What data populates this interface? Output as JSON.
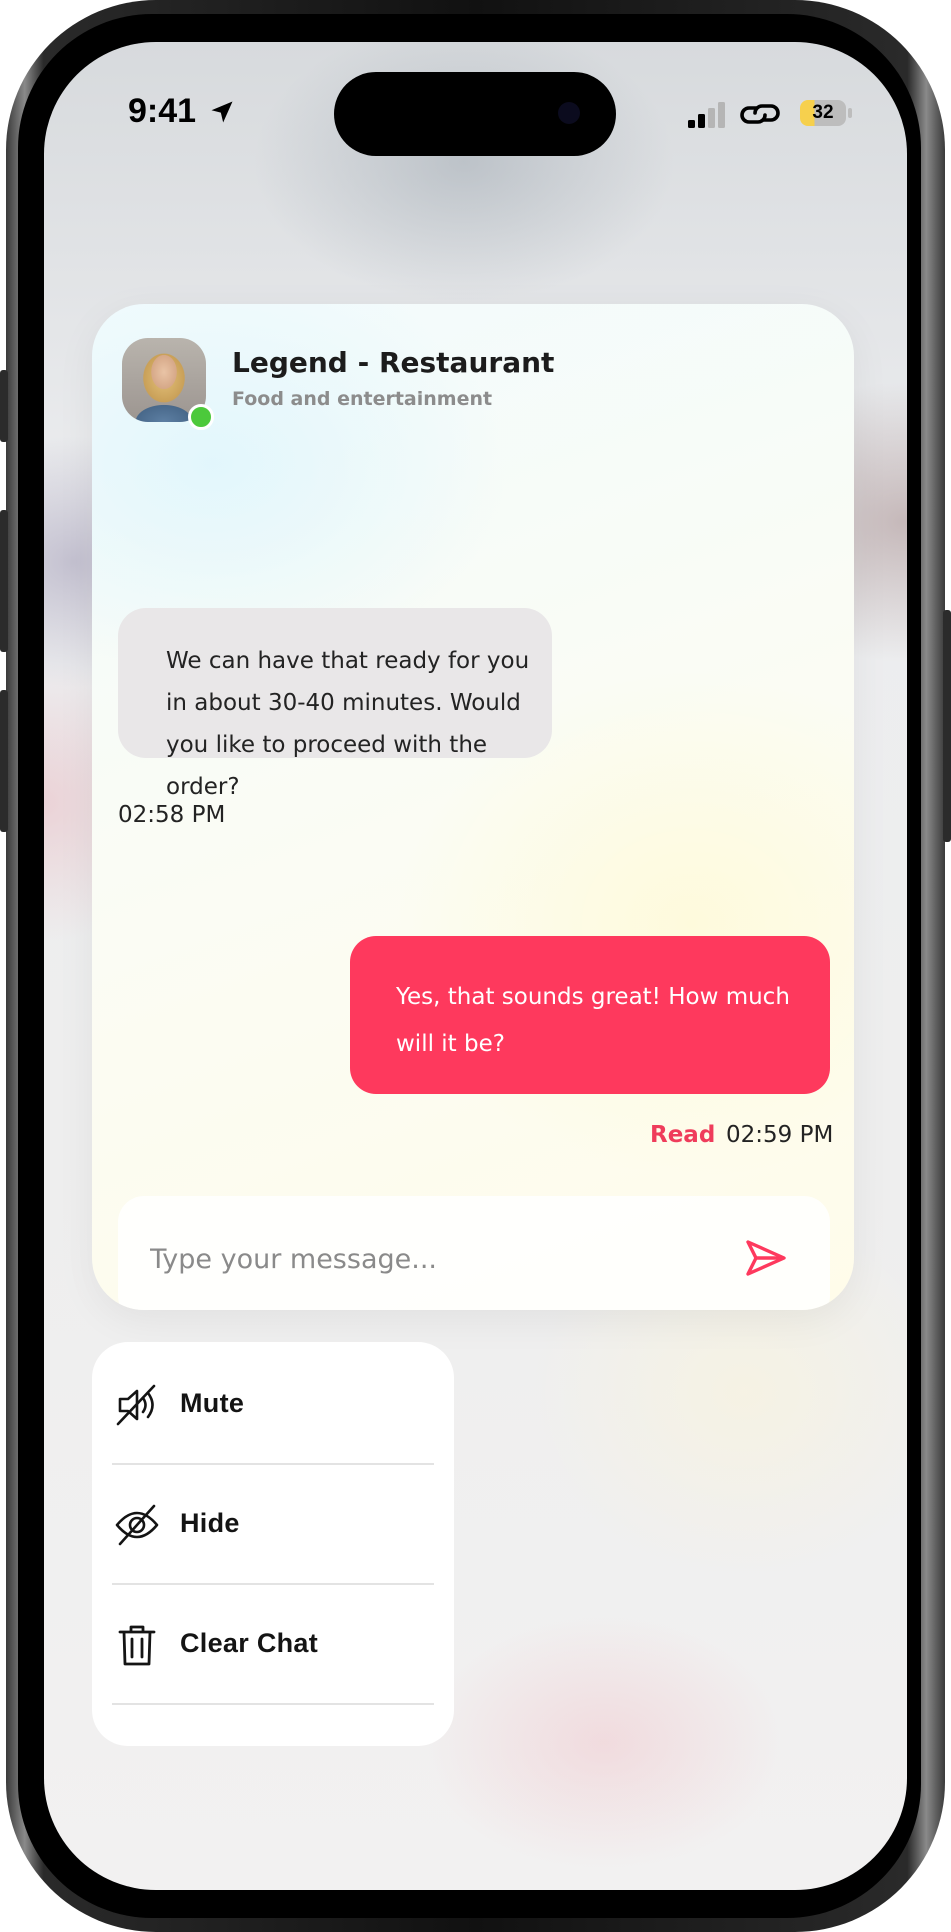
{
  "status_bar": {
    "time": "9:41",
    "battery_level": "32"
  },
  "chat": {
    "contact_name": "Legend - Restaurant",
    "contact_subtitle": "Food and entertainment",
    "online": true,
    "messages": [
      {
        "direction": "incoming",
        "text": "We can have that ready for you in about 30-40 minutes. Would you like to proceed with the order?",
        "time": "02:58 PM"
      },
      {
        "direction": "outgoing",
        "text": "Yes, that sounds great! How much will it be?",
        "status": "Read",
        "time": "02:59 PM"
      }
    ],
    "input": {
      "placeholder": "Type your message...",
      "value": ""
    }
  },
  "menu": {
    "items": [
      {
        "label": "Mute",
        "icon": "mute-speaker-icon"
      },
      {
        "label": "Hide",
        "icon": "hide-eye-icon"
      },
      {
        "label": "Clear Chat",
        "icon": "trash-icon"
      }
    ]
  },
  "colors": {
    "accent": "#fe395d",
    "online": "#4cc93b",
    "incoming_bubble": "#e9e7e8"
  }
}
